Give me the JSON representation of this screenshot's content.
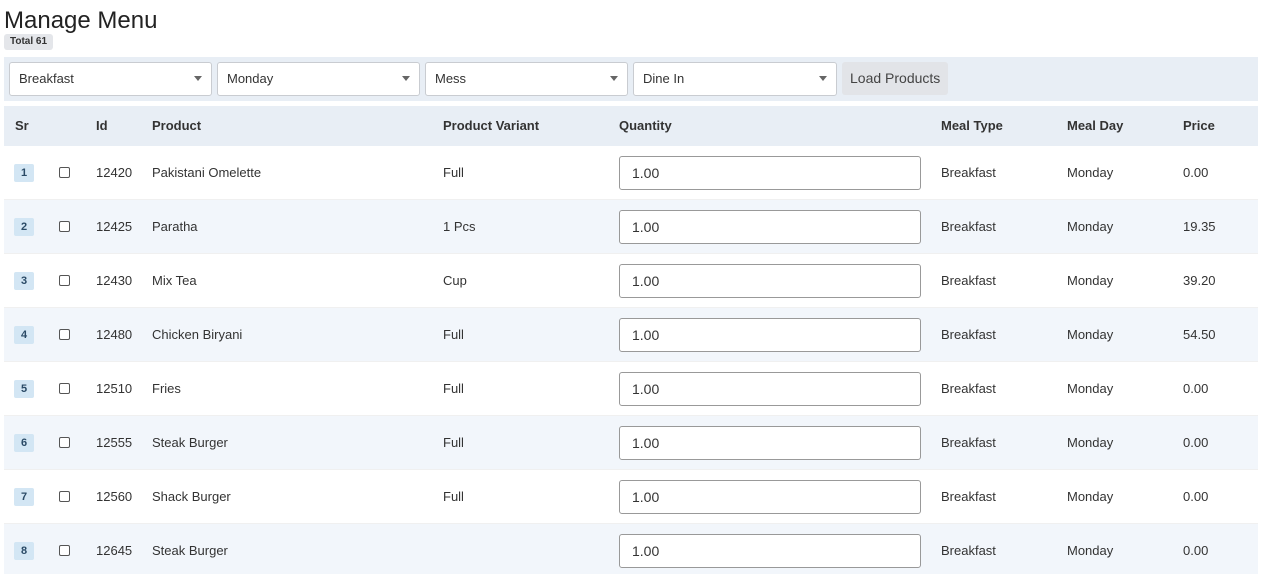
{
  "page": {
    "title": "Manage Menu",
    "total_badge": "Total 61"
  },
  "filters": {
    "meal_type": "Breakfast",
    "meal_day": "Monday",
    "location": "Mess",
    "order_type": "Dine In",
    "load_button": "Load Products"
  },
  "table": {
    "headers": {
      "sr": "Sr",
      "id": "Id",
      "product": "Product",
      "variant": "Product Variant",
      "quantity": "Quantity",
      "meal_type": "Meal Type",
      "meal_day": "Meal Day",
      "price": "Price"
    },
    "rows": [
      {
        "sr": "1",
        "id": "12420",
        "product": "Pakistani Omelette",
        "variant": "Full",
        "quantity": "1.00",
        "meal_type": "Breakfast",
        "meal_day": "Monday",
        "price": "0.00"
      },
      {
        "sr": "2",
        "id": "12425",
        "product": "Paratha",
        "variant": "1 Pcs",
        "quantity": "1.00",
        "meal_type": "Breakfast",
        "meal_day": "Monday",
        "price": "19.35"
      },
      {
        "sr": "3",
        "id": "12430",
        "product": "Mix Tea",
        "variant": "Cup",
        "quantity": "1.00",
        "meal_type": "Breakfast",
        "meal_day": "Monday",
        "price": "39.20"
      },
      {
        "sr": "4",
        "id": "12480",
        "product": "Chicken Biryani",
        "variant": "Full",
        "quantity": "1.00",
        "meal_type": "Breakfast",
        "meal_day": "Monday",
        "price": "54.50"
      },
      {
        "sr": "5",
        "id": "12510",
        "product": "Fries",
        "variant": "Full",
        "quantity": "1.00",
        "meal_type": "Breakfast",
        "meal_day": "Monday",
        "price": "0.00"
      },
      {
        "sr": "6",
        "id": "12555",
        "product": "Steak Burger",
        "variant": "Full",
        "quantity": "1.00",
        "meal_type": "Breakfast",
        "meal_day": "Monday",
        "price": "0.00"
      },
      {
        "sr": "7",
        "id": "12560",
        "product": "Shack Burger",
        "variant": "Full",
        "quantity": "1.00",
        "meal_type": "Breakfast",
        "meal_day": "Monday",
        "price": "0.00"
      },
      {
        "sr": "8",
        "id": "12645",
        "product": "Steak Burger",
        "variant": "",
        "quantity": "1.00",
        "meal_type": "Breakfast",
        "meal_day": "Monday",
        "price": "0.00"
      }
    ]
  }
}
